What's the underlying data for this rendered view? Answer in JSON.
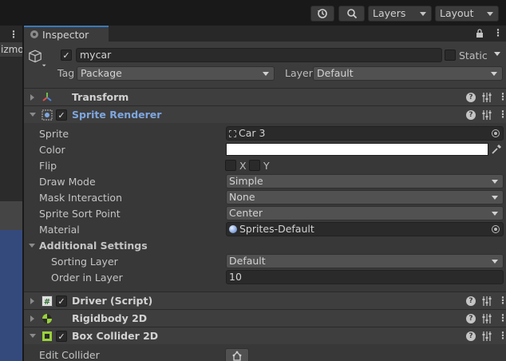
{
  "toolbar": {
    "history_icon": "history-icon",
    "search_icon": "search-icon",
    "layers_label": "Layers",
    "layout_label": "Layout"
  },
  "left_panel": {
    "menu_dots": "⋮",
    "gizmo_label": "izmo"
  },
  "inspector": {
    "tab_label": "Inspector",
    "object_name": "mycar",
    "static_label": "Static",
    "active_checked": true,
    "static_checked": false,
    "tag_label": "Tag",
    "tag_value": "Package",
    "layer_label": "Layer",
    "layer_value": "Default"
  },
  "components": {
    "transform": {
      "title": "Transform",
      "expanded": false
    },
    "sprite_renderer": {
      "title": "Sprite Renderer",
      "expanded": true,
      "enabled": true,
      "props": {
        "sprite_label": "Sprite",
        "sprite_value": "Car 3",
        "color_label": "Color",
        "color_value": "#ffffff",
        "flip_label": "Flip",
        "flip_x": "X",
        "flip_y": "Y",
        "draw_mode_label": "Draw Mode",
        "draw_mode_value": "Simple",
        "mask_label": "Mask Interaction",
        "mask_value": "None",
        "sort_point_label": "Sprite Sort Point",
        "sort_point_value": "Center",
        "material_label": "Material",
        "material_value": "Sprites-Default",
        "additional_label": "Additional Settings",
        "sorting_layer_label": "Sorting Layer",
        "sorting_layer_value": "Default",
        "order_label": "Order in Layer",
        "order_value": "10"
      }
    },
    "driver": {
      "title": "Driver (Script)",
      "expanded": false,
      "enabled": true
    },
    "rigidbody": {
      "title": "Rigidbody 2D",
      "expanded": false
    },
    "box_collider": {
      "title": "Box Collider 2D",
      "expanded": true,
      "enabled": true,
      "edit_collider_label": "Edit Collider"
    }
  },
  "colors": {
    "accent_tab": "#3a79bb",
    "selected_component": "#7ea6e0",
    "scene_blue": "#344a7c"
  }
}
